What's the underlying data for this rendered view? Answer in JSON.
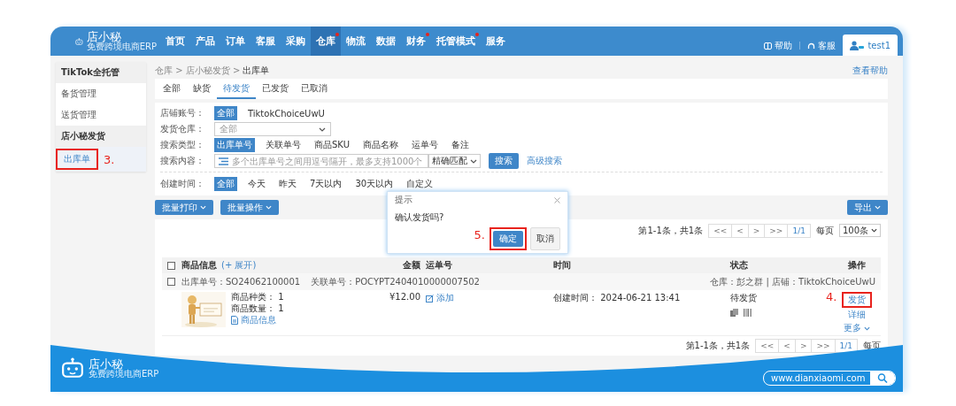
{
  "nav": {
    "logo": {
      "name": "店小秘",
      "tagline": "免费跨境电商ERP"
    },
    "items": [
      {
        "label": "首页",
        "selected": false,
        "dot": false
      },
      {
        "label": "产品",
        "selected": false,
        "dot": false
      },
      {
        "label": "订单",
        "selected": false,
        "dot": false
      },
      {
        "label": "客服",
        "selected": false,
        "dot": false
      },
      {
        "label": "采购",
        "selected": false,
        "dot": false
      },
      {
        "label": "仓库",
        "selected": true,
        "dot": true
      },
      {
        "label": "物流",
        "selected": false,
        "dot": false
      },
      {
        "label": "数据",
        "selected": false,
        "dot": false
      },
      {
        "label": "财务",
        "selected": false,
        "dot": true
      },
      {
        "label": "托管模式",
        "selected": false,
        "dot": true
      },
      {
        "label": "服务",
        "selected": false,
        "dot": false
      }
    ],
    "help": "帮助",
    "support": "客服",
    "user": "test1"
  },
  "sidebar": {
    "groups": [
      {
        "title": "TikTok全托管",
        "items": [
          {
            "label": "备货管理",
            "selected": false
          },
          {
            "label": "送货管理",
            "selected": false
          }
        ]
      },
      {
        "title": "店小秘发货",
        "items": [
          {
            "label": "出库单",
            "selected": true,
            "annotation": "3."
          }
        ]
      }
    ]
  },
  "breadcrumb": "仓库 > 店小秘发货 > **出库单**",
  "help_link": "查看帮助",
  "tabs": [
    {
      "label": "全部",
      "selected": false
    },
    {
      "label": "缺货",
      "selected": false
    },
    {
      "label": "待发货",
      "selected": true
    },
    {
      "label": "已发货",
      "selected": false
    },
    {
      "label": "已取消",
      "selected": false
    }
  ],
  "filters": [
    {
      "label": "店铺账号：",
      "kind": "chips",
      "options": [
        {
          "label": "全部",
          "selected": true
        },
        {
          "label": "TiktokChoiceUwU",
          "selected": false
        }
      ]
    },
    {
      "label": "发货仓库：",
      "kind": "select",
      "value": "全部"
    },
    {
      "label": "搜索类型：",
      "kind": "chips",
      "options": [
        {
          "label": "出库单号",
          "selected": true
        },
        {
          "label": "关联单号",
          "selected": false
        },
        {
          "label": "商品SKU",
          "selected": false
        },
        {
          "label": "商品名称",
          "selected": false
        },
        {
          "label": "运单号",
          "selected": false
        },
        {
          "label": "备注",
          "selected": false
        }
      ]
    },
    {
      "label": "搜索内容：",
      "kind": "search",
      "placeholder": "多个出库单号之间用逗号隔开，最多支持1000个",
      "match": "精确匹配",
      "button": "搜索",
      "advanced": "高级搜索"
    },
    {
      "label": "创建时间：",
      "kind": "chips",
      "options": [
        {
          "label": "全部",
          "selected": true
        },
        {
          "label": "今天",
          "selected": false
        },
        {
          "label": "昨天",
          "selected": false
        },
        {
          "label": "7天以内",
          "selected": false
        },
        {
          "label": "30天以内",
          "selected": false
        },
        {
          "label": "自定义",
          "selected": false
        }
      ]
    }
  ],
  "actions": [
    "批量打印",
    "批量操作"
  ],
  "export": "导出",
  "pagination": {
    "summary": "第1-1条，共1条",
    "buttons": [
      "<<",
      "<",
      ">",
      ">>"
    ],
    "page": "1/1",
    "per_page_label": "每页",
    "per_page": "100条"
  },
  "pagination_bottom": {
    "summary": "第1-1条，共1条",
    "buttons": [
      "<<",
      "<",
      ">",
      ">>"
    ],
    "page": "1/1",
    "per_page_label": "每页"
  },
  "table": {
    "checked": false,
    "columns": [
      "商品信息",
      "金额",
      "运单号",
      "时间",
      "状态",
      "操作"
    ],
    "expand": "(+ 展开)",
    "orders": [
      {
        "checked": false,
        "order_no": "出库单号：SO24062100001",
        "ref_no": "关联单号：POCYPT2404010000007502",
        "location": "仓库：彭之群 | 店铺：TiktokChoiceUwU",
        "kinds": "商品种类：  1",
        "quantity": "商品数量：  1",
        "info_link": "商品信息",
        "amount": "¥12.00",
        "tracking_link": "添加",
        "created": "创建时间：  2024-06-21 13:41",
        "status": "待发货",
        "ops": [
          {
            "label": "发货",
            "annotation": "4.",
            "menu": false
          },
          {
            "label": "详细",
            "menu": false
          },
          {
            "label": "更多",
            "menu": true
          }
        ]
      }
    ]
  },
  "dialog": {
    "title": "提示",
    "message": "确认发货吗?",
    "buttons": [
      {
        "label": "确定",
        "kind": "primary",
        "annotation": "5."
      },
      {
        "label": "取消",
        "kind": "default"
      }
    ]
  },
  "footer": {
    "logo": {
      "name": "店小秘",
      "tagline": "免费跨境电商ERP"
    },
    "url": "www.dianxiaomi.com"
  }
}
